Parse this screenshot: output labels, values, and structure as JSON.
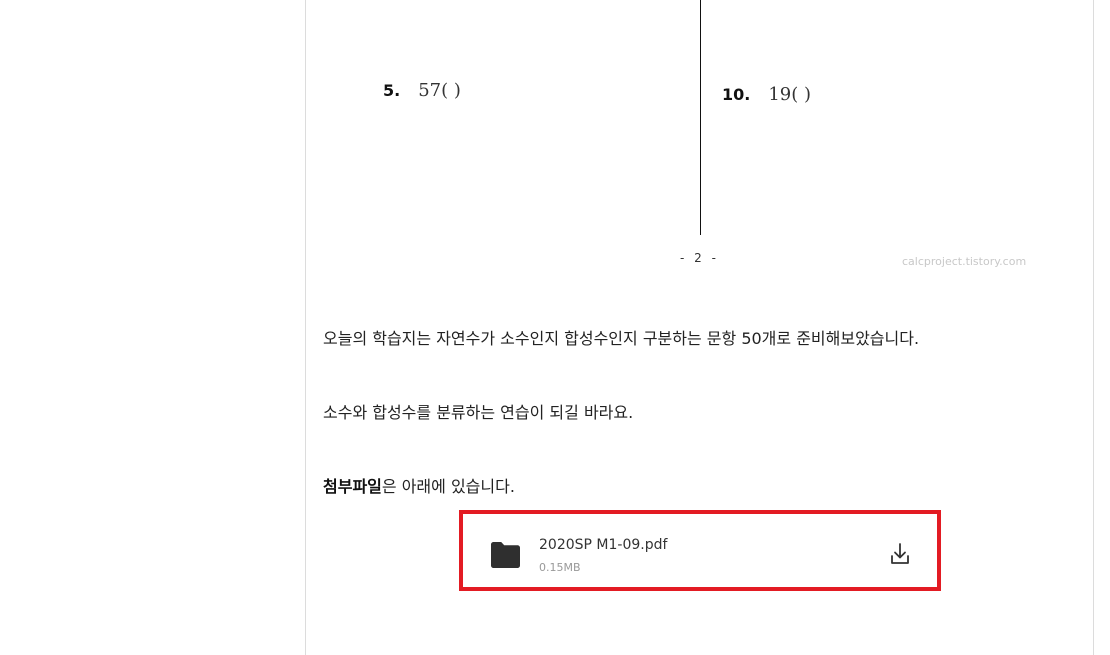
{
  "worksheet": {
    "problems": [
      {
        "number": "5.",
        "value": "57",
        "blank": "(     )"
      },
      {
        "number": "10.",
        "value": "19",
        "blank": "(     )"
      }
    ],
    "page_number": "- 2 -",
    "watermark": "calcproject.tistory.com"
  },
  "post": {
    "paragraph_1": "오늘의 학습지는 자연수가 소수인지 합성수인지 구분하는 문항 50개로 준비해보았습니다.",
    "paragraph_2": "소수와 합성수를 분류하는 연습이 되길 바라요.",
    "paragraph_3_bold": "첨부파일",
    "paragraph_3_rest": "은 아래에 있습니다."
  },
  "attachment": {
    "file_name": "2020SP M1-09.pdf",
    "file_size": "0.15MB",
    "icon": "folder-icon",
    "action_icon": "download-icon",
    "highlight_color": "#e31b23"
  }
}
